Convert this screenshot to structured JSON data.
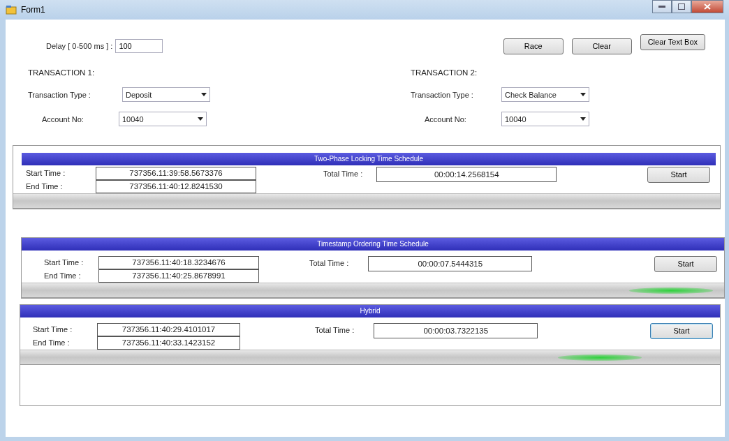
{
  "window": {
    "title": "Form1"
  },
  "delay": {
    "label": "Delay  [ 0-500 ms ] :",
    "value": "100"
  },
  "buttons": [
    "Race",
    "Clear",
    "Clear Text Box"
  ],
  "transactions": [
    {
      "heading": "TRANSACTION 1:",
      "type_label": "Transaction Type :",
      "type_value": "Deposit",
      "account_label": "Account No:",
      "account_value": "10040"
    },
    {
      "heading": "TRANSACTION 2:",
      "type_label": "Transaction Type :",
      "type_value": "Check Balance",
      "account_label": "Account No:",
      "account_value": "10040"
    }
  ],
  "schedules": [
    {
      "title": "Two-Phase Locking Time Schedule",
      "start_label": "Start Time :",
      "start_value": "737356.11:39:58.5673376",
      "end_label": "End Time :",
      "end_value": "737356.11:40:12.8241530",
      "total_label": "Total Time :",
      "total_value": "00:00:14.2568154",
      "button": "Start",
      "focused": false,
      "running": false
    },
    {
      "title": "Timestamp Ordering Time Schedule",
      "start_label": "Start Time :",
      "start_value": "737356.11:40:18.3234676",
      "end_label": "End Time :",
      "end_value": "737356.11:40:25.8678991",
      "total_label": "Total Time :",
      "total_value": "00:00:07.5444315",
      "button": "Start",
      "focused": false,
      "running": true
    },
    {
      "title": "Hybrid",
      "start_label": "Start Time :",
      "start_value": "737356.11:40:29.4101017",
      "end_label": "End Time :",
      "end_value": "737356.11:40:33.1423152",
      "total_label": "Total Time :",
      "total_value": "00:00:03.7322135",
      "button": "Start",
      "focused": true,
      "running": true
    }
  ]
}
